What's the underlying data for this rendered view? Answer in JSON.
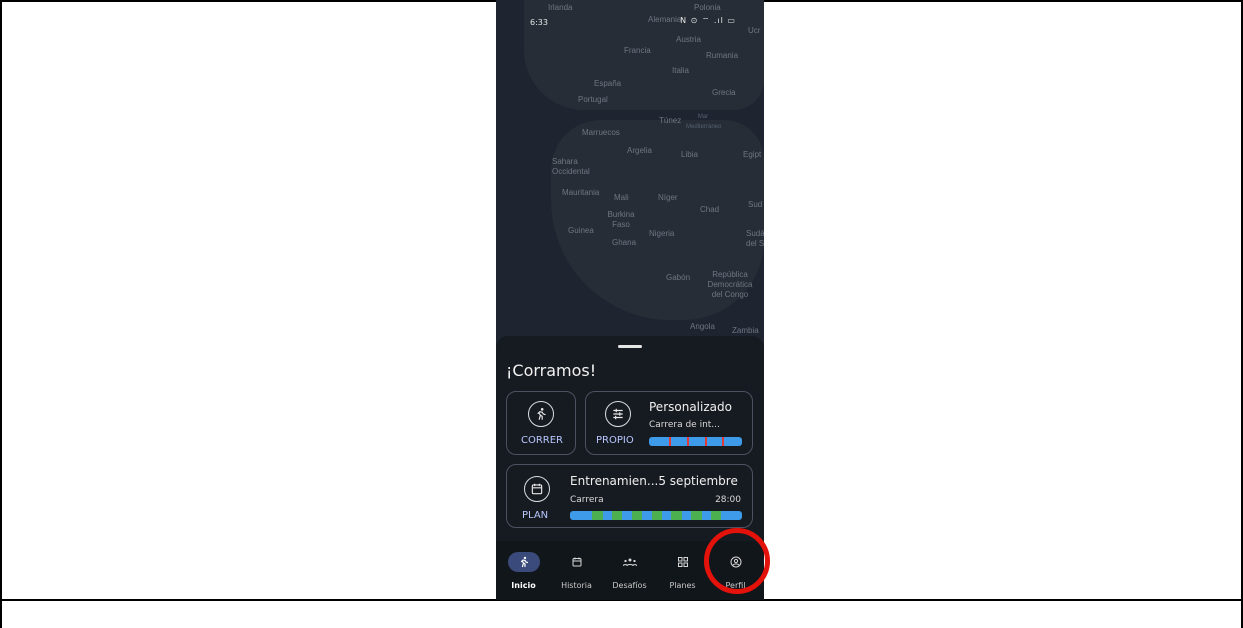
{
  "status": {
    "time": "6:33",
    "icons": "N ⊙ ⌔ .ıl ▭"
  },
  "map": {
    "labels": [
      "Irlanda",
      "Alemania",
      "Polonia",
      "Ucr",
      "Austria",
      "Francia",
      "Rumania",
      "Italia",
      "España",
      "Portugal",
      "Grecia",
      "Túnez",
      "Mar Mediterráneo",
      "Marruecos",
      "Argelia",
      "Libia",
      "Egipt",
      "Sahara Occidental",
      "Mauritania",
      "Mali",
      "Níger",
      "Chad",
      "Sud",
      "Burkina Faso",
      "Guinea",
      "Ghana",
      "Nigeria",
      "Sudá del S",
      "Gabón",
      "República Democrática del Congo",
      "Angola",
      "Zambia"
    ]
  },
  "sheet": {
    "title": "¡Corramos!",
    "run_card": {
      "label": "CORRER",
      "icon": "run-icon"
    },
    "custom_card": {
      "label": "PROPIO",
      "title": "Personalizado",
      "subtitle": "Carrera de int...",
      "progress": 1.0
    },
    "plan_card": {
      "label": "PLAN",
      "title": "Entrenamien...5 septiembre",
      "subtitle": "Carrera",
      "duration": "28:00"
    }
  },
  "nav": {
    "items": [
      {
        "label": "Inicio",
        "icon": "run-icon",
        "active": true
      },
      {
        "label": "Historia",
        "icon": "calendar-icon"
      },
      {
        "label": "Desafíos",
        "icon": "group-icon"
      },
      {
        "label": "Planes",
        "icon": "grid-icon"
      },
      {
        "label": "Perfil",
        "icon": "profile-icon"
      }
    ]
  },
  "colors": {
    "accent": "#3e9be9",
    "highlight_ring": "#e3120b",
    "interval_segment": "#e53935",
    "plan_segment": "#4caf50"
  }
}
